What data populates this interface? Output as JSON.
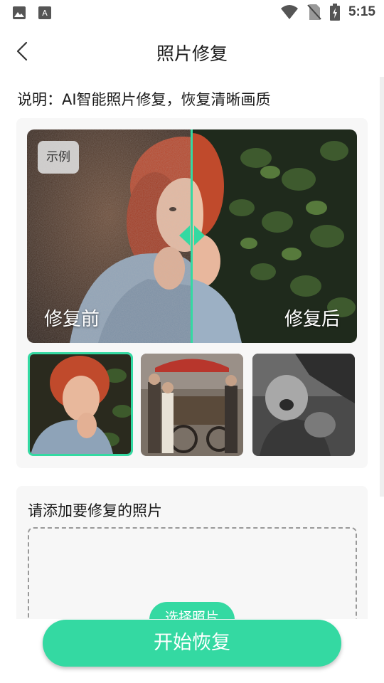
{
  "status_bar": {
    "time": "5:15",
    "icons": [
      "image-icon",
      "font-app-icon",
      "wifi-icon",
      "no-sim-icon",
      "battery-charging-icon"
    ]
  },
  "header": {
    "title": "照片修复",
    "back_icon": "chevron-left-icon"
  },
  "description": "说明：AI智能照片修复，恢复清晰画质",
  "example": {
    "badge": "示例",
    "before_label": "修复前",
    "after_label": "修复后",
    "accent": "#34d9a2"
  },
  "thumbnails": [
    {
      "name": "red-hair-portrait",
      "selected": true
    },
    {
      "name": "street-vendor-scene",
      "selected": false
    },
    {
      "name": "crying-child-bw",
      "selected": false
    }
  ],
  "upload": {
    "title": "请添加要修复的照片",
    "choose_label": "选择照片"
  },
  "primary_action": {
    "label": "开始恢复",
    "color": "#34d9a2"
  }
}
